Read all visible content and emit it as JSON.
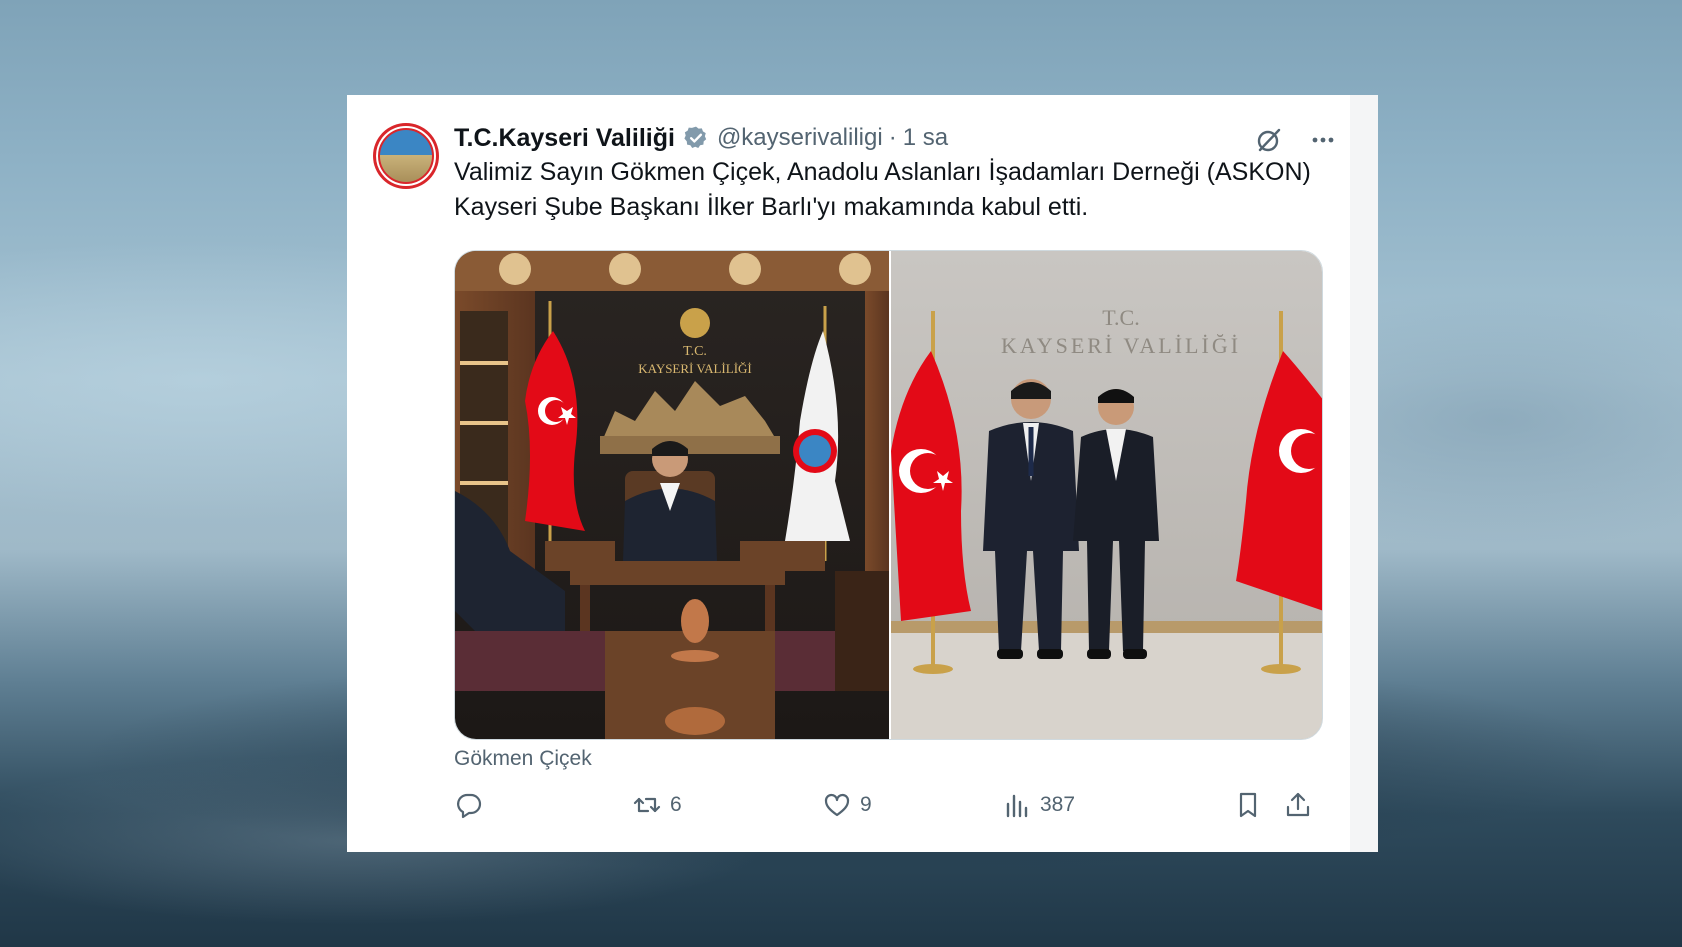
{
  "tweet": {
    "display_name": "T.C.Kayseri Valiliği",
    "handle": "@kayserivaliligi",
    "separator": "·",
    "time": "1 sa",
    "text": "Valimiz Sayın Gökmen Çiçek, Anadolu Aslanları İşadamları Derneği (ASKON) Kayseri Şube Başkanı İlker Barlı'yı makamında kabul etti.",
    "tagged": "Gökmen Çiçek",
    "stats": {
      "replies": "",
      "retweets": "6",
      "likes": "9",
      "views": "387"
    },
    "photo_text": {
      "left_sign_line1": "T.C.",
      "left_sign_line2": "KAYSERİ VALİLİĞİ",
      "right_sign_line1": "T.C.",
      "right_sign_line2": "KAYSERİ VALİLİĞİ"
    }
  },
  "icons": {
    "verified": "verified-badge-icon",
    "grok": "grok-icon",
    "more": "more-dots-icon",
    "reply": "reply-icon",
    "retweet": "retweet-icon",
    "like": "heart-icon",
    "views": "views-chart-icon",
    "bookmark": "bookmark-icon",
    "share": "share-icon"
  },
  "colors": {
    "verified_badge": "#829aab",
    "text_primary": "#0f1419",
    "text_secondary": "#536471",
    "flag_red": "#e30a17"
  }
}
